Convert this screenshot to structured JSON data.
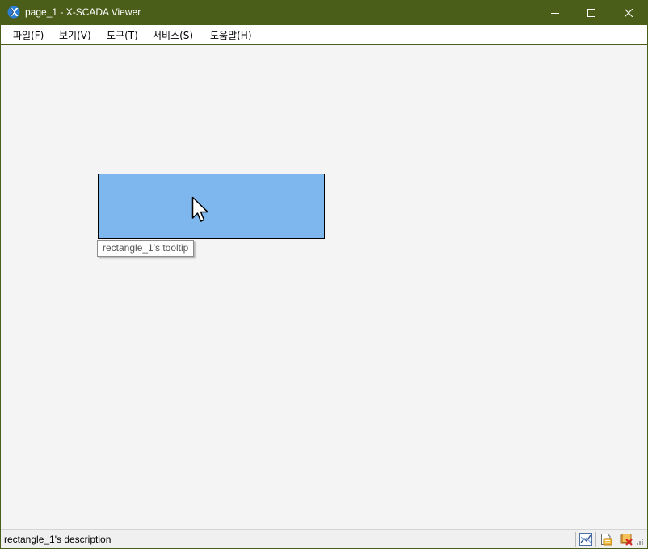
{
  "window": {
    "title": "page_1 - X-SCADA Viewer"
  },
  "menu": [
    {
      "label": "파일(F)"
    },
    {
      "label": "보기(V)"
    },
    {
      "label": "도구(T)"
    },
    {
      "label": "서비스(S)"
    },
    {
      "label": "도움말(H)"
    }
  ],
  "canvas": {
    "shape_name": "rectangle_1",
    "shape_fill": "#7eb6ee",
    "tooltip": "rectangle_1's tooltip"
  },
  "status": {
    "text": "rectangle_1's description",
    "icons": [
      "trend-chart-icon",
      "report-icon",
      "alarm-delete-icon"
    ]
  },
  "colors": {
    "titlebar": "#4a5e1a",
    "canvas_bg": "#f4f4f5"
  }
}
